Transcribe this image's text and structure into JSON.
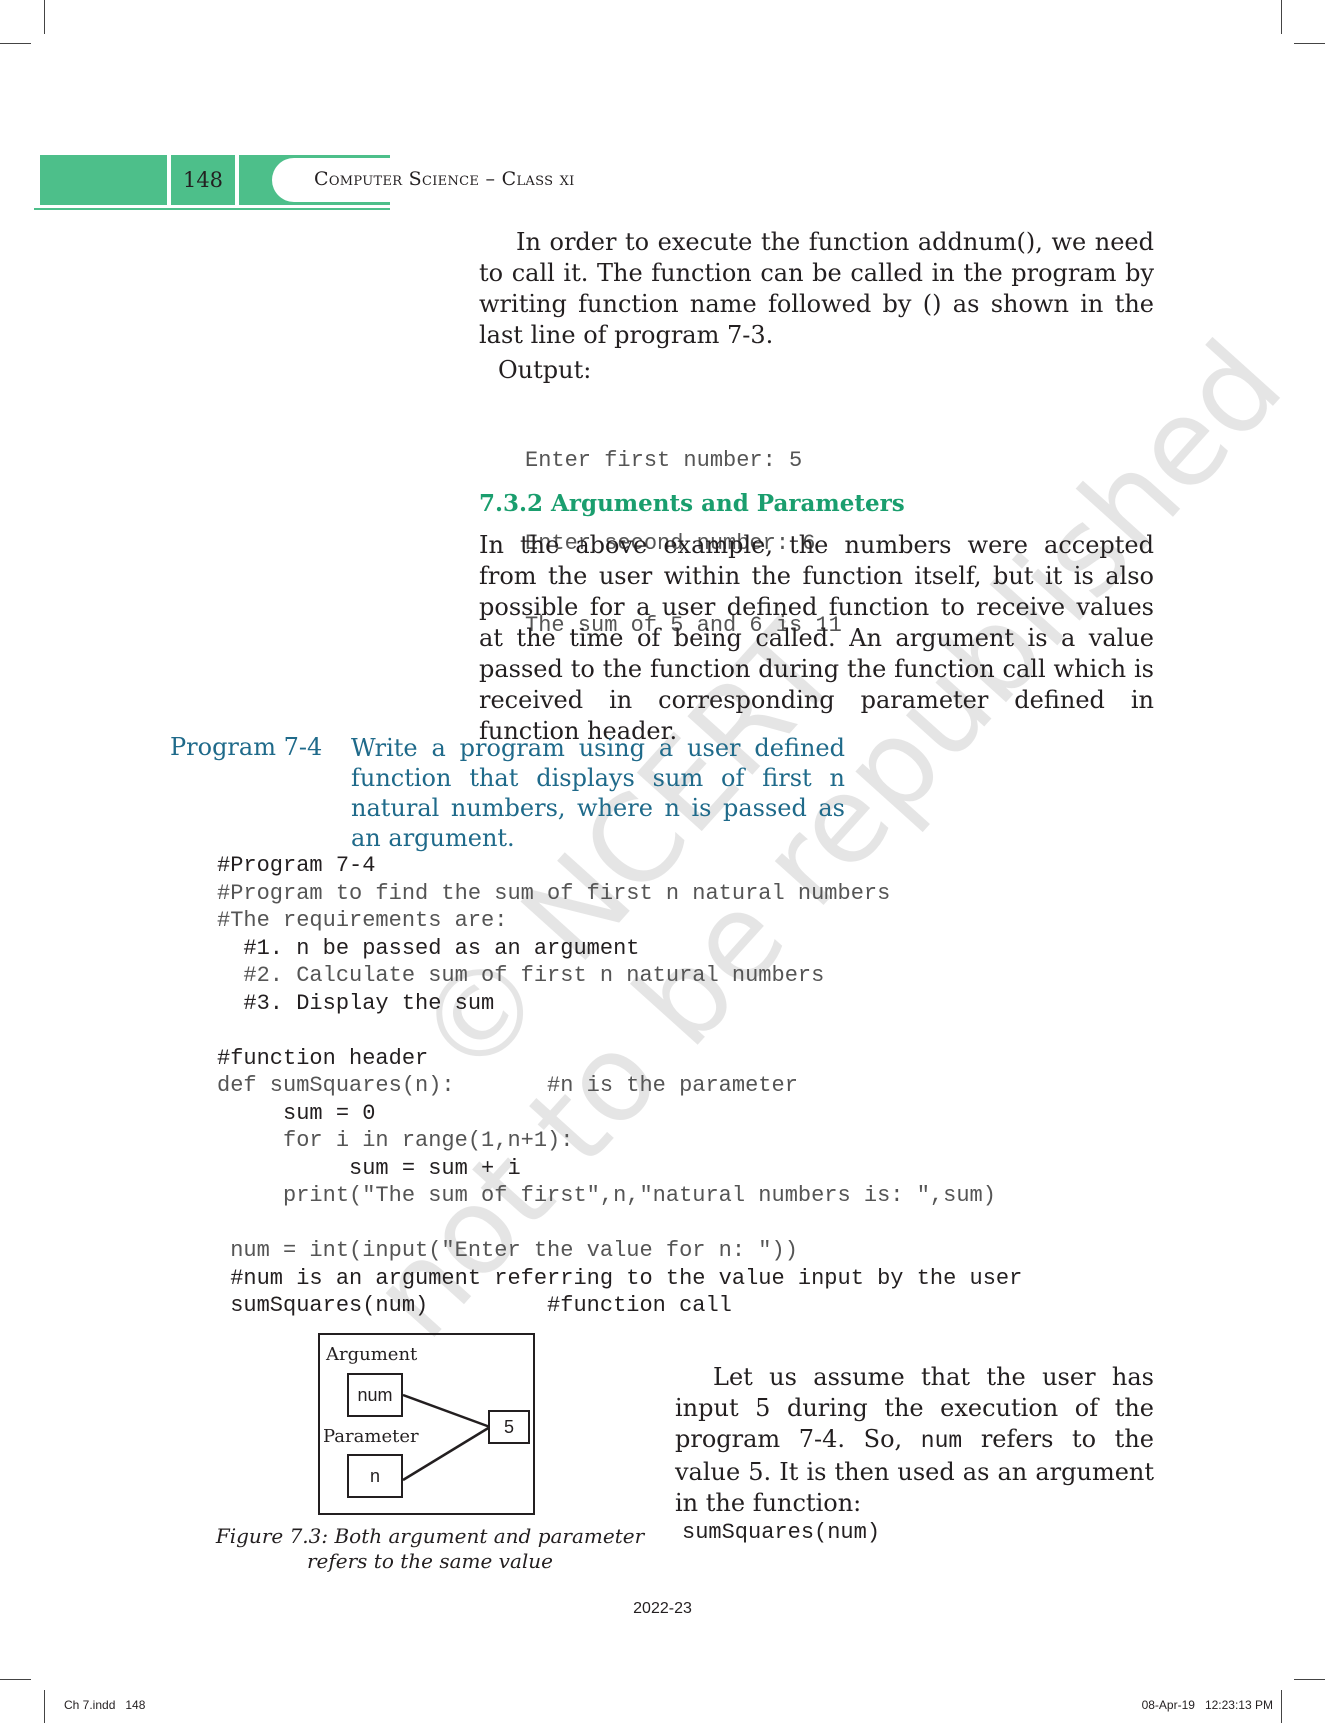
{
  "header": {
    "page_number": "148",
    "running_title": "Computer Science – Class xi",
    "accent_color": "#4dbf8a"
  },
  "intro": {
    "paragraph": "In order to execute the function addnum(), we need to call it. The function can be called in the program by writing function name followed by () as shown in the last line of program 7-3.",
    "output_label": "Output:",
    "output_lines": [
      "Enter first number: 5",
      "Enter second number: 6",
      "The sum of 5 and 6 is 11"
    ]
  },
  "section": {
    "heading": "7.3.2 Arguments and Parameters",
    "heading_color": "#1a9e6e",
    "paragraph": "In the above example, the numbers were accepted from the user within the function itself, but it is also possible for a user defined function to receive values at the time of being called. An argument is a value passed to the function during the function call which is received in corresponding parameter defined in function header."
  },
  "program": {
    "label": "Program 7-4",
    "description_lines": [
      "Write a program using a user defined",
      "function that displays sum of first n",
      "natural numbers, where n is passed as",
      "an argument."
    ],
    "label_color": "#1f6a8a",
    "code_lines": [
      "#Program 7-4",
      "#Program to find the sum of first n natural numbers",
      "#The requirements are:",
      "  #1. n be passed as an argument",
      "  #2. Calculate sum of first n natural numbers",
      "  #3. Display the sum",
      "",
      "#function header",
      "def sumSquares(n):       #n is the parameter",
      "     sum = 0",
      "     for i in range(1,n+1):",
      "          sum = sum + i",
      "     print(\"The sum of first\",n,\"natural numbers is: \",sum)",
      "",
      " num = int(input(\"Enter the value for n: \"))",
      " #num is an argument referring to the value input by the user",
      " sumSquares(num)         #function call"
    ]
  },
  "figure": {
    "argument_label": "Argument",
    "argument_box": "num",
    "parameter_label": "Parameter",
    "parameter_box": "n",
    "value_box": "5",
    "caption_line1": "Figure 7.3: Both argument and parameter",
    "caption_line2": "refers to the same value"
  },
  "side_note": {
    "paragraph_before": "Let us assume that the user has input 5 during the execution of the program 7-4. So,",
    "code_word": "num",
    "paragraph_after": "refers to the value 5. It is then used as an argument in the function:",
    "code_line": "sumSquares(num)"
  },
  "footer": {
    "year": "2022-23",
    "file_info": "Ch 7.indd   148",
    "timestamp": "08-Apr-19   12:23:13 PM"
  },
  "watermark": {
    "line1": "© NCERT",
    "line2": "not to be republished"
  }
}
